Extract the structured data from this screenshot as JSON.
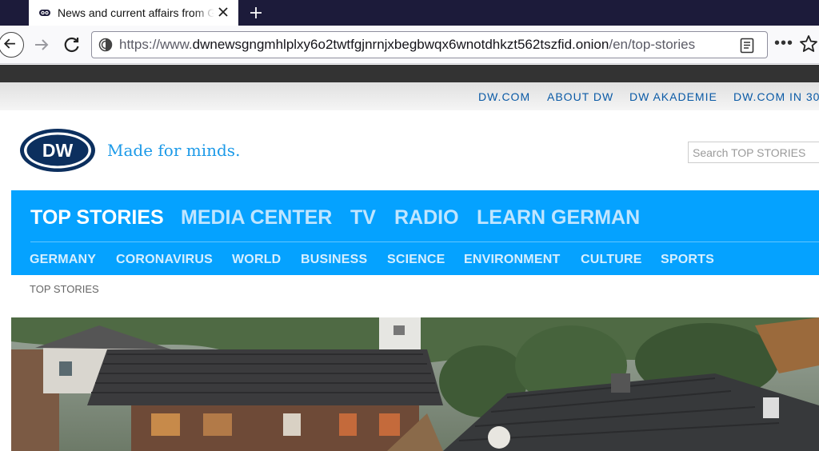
{
  "browser": {
    "tab_title": "News and current affairs from Germany and around the world",
    "url_scheme": "https://www.",
    "url_host": "dwnewsgngmhlplxy6o2twtfgjnrnjxbegbwqx6wnotdhkzt562tszfid.onion",
    "url_path": "/en/top-stories",
    "icons": {
      "favicon": "tor-onion-icon",
      "close": "close-icon",
      "new_tab": "plus-icon",
      "back": "back-arrow-icon",
      "forward": "forward-arrow-icon",
      "reload": "reload-icon",
      "site_info": "onion-site-icon",
      "reader": "reader-view-icon",
      "menu": "more-icon",
      "bookmark": "star-icon"
    },
    "more_label": "•••"
  },
  "page": {
    "top_links": [
      "DW.COM",
      "ABOUT DW",
      "DW AKADEMIE",
      "DW.COM IN 30"
    ],
    "logo_text": "DW",
    "tagline": "Made for minds.",
    "search_placeholder": "Search TOP STORIES",
    "main_nav": [
      {
        "label": "TOP STORIES",
        "active": true
      },
      {
        "label": "MEDIA CENTER",
        "active": false
      },
      {
        "label": "TV",
        "active": false
      },
      {
        "label": "RADIO",
        "active": false
      },
      {
        "label": "LEARN GERMAN",
        "active": false
      }
    ],
    "sub_nav": [
      "GERMANY",
      "CORONAVIRUS",
      "WORLD",
      "BUSINESS",
      "SCIENCE",
      "ENVIRONMENT",
      "CULTURE",
      "SPORTS"
    ],
    "breadcrumb": "TOP STORIES",
    "colors": {
      "brand_blue": "#05a2ff",
      "link_blue": "#0a5aa6",
      "tagline_blue": "#1c9ae8",
      "logo_navy": "#0c2f5e"
    }
  }
}
